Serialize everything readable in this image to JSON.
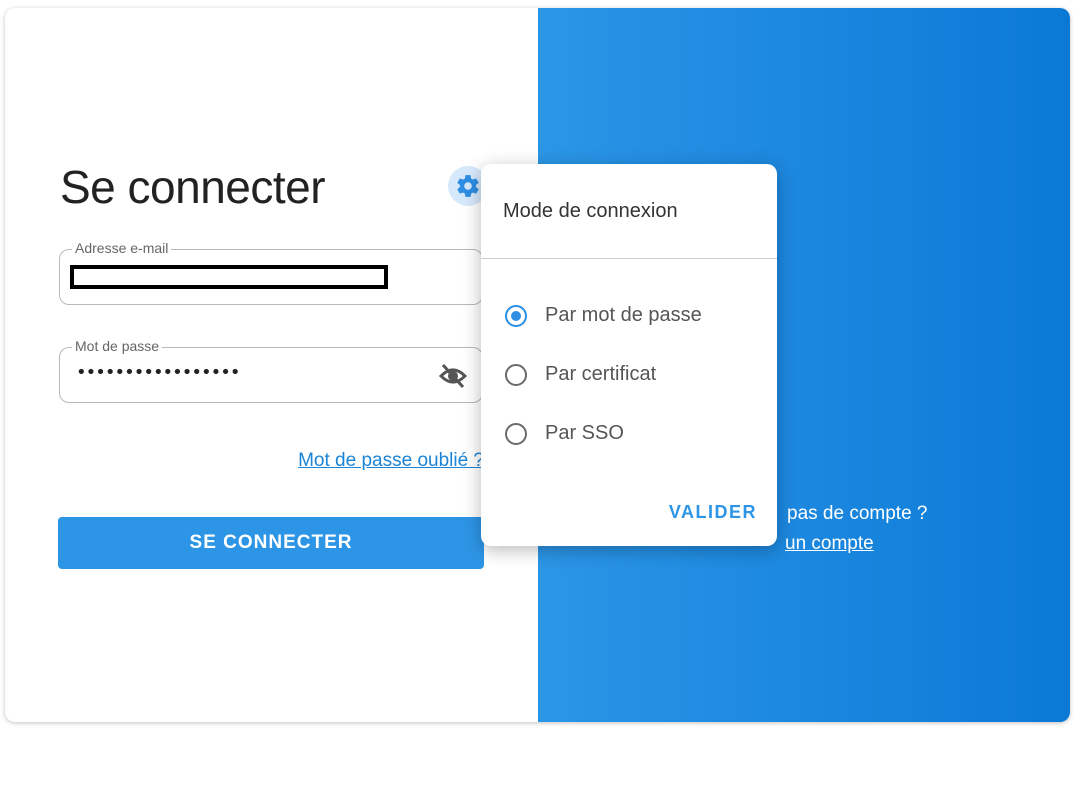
{
  "login": {
    "title": "Se connecter",
    "email_label": "Adresse e-mail",
    "password_label": "Mot de passe",
    "password_value": "•••••••••••••••••",
    "forgot_link": "Mot de passe oublié ?",
    "submit_label": "SE CONNECTER"
  },
  "right_panel": {
    "no_account_text": "pas de compte ?",
    "create_account_link": "un compte"
  },
  "popover": {
    "title": "Mode de connexion",
    "options": [
      {
        "label": "Par mot de passe",
        "checked": true
      },
      {
        "label": "Par certificat",
        "checked": false
      },
      {
        "label": "Par SSO",
        "checked": false
      }
    ],
    "validate_label": "VALIDER"
  },
  "icons": {
    "settings": "gear-icon",
    "password_visibility": "eye-off-icon",
    "illustration_lock": "lock-icon"
  },
  "colors": {
    "accent": "#2d95e6",
    "link": "#1b84d6",
    "panel_gradient_start": "#2b95e6",
    "panel_gradient_end": "#0a79d6"
  }
}
